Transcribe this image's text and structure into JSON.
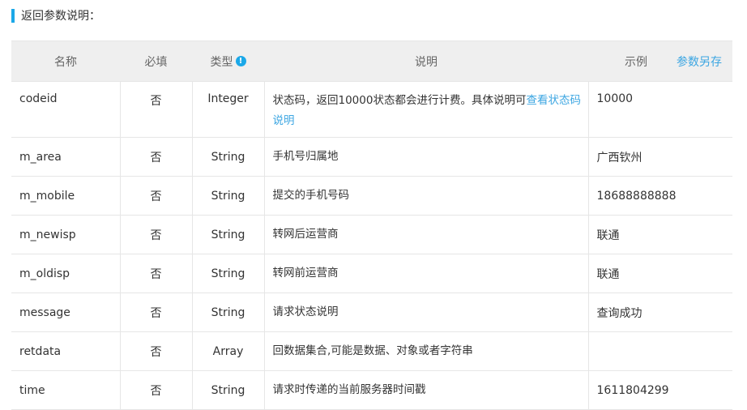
{
  "section_title": "返回参数说明：",
  "table": {
    "headers": {
      "name": "名称",
      "required": "必填",
      "type": "类型",
      "description": "说明",
      "example": "示例",
      "save_link": "参数另存"
    },
    "codeid": {
      "name": "codeid",
      "required": "否",
      "type": "Integer",
      "desc_text": "状态码，返回10000状态都会进行计费。具体说明可",
      "desc_link": "查看状态码说明",
      "example": "10000"
    },
    "rows": [
      {
        "name": "m_area",
        "required": "否",
        "type": "String",
        "desc": "手机号归属地",
        "example": "广西钦州"
      },
      {
        "name": "m_mobile",
        "required": "否",
        "type": "String",
        "desc": "提交的手机号码",
        "example": "18688888888"
      },
      {
        "name": "m_newisp",
        "required": "否",
        "type": "String",
        "desc": "转网后运营商",
        "example": "联通"
      },
      {
        "name": "m_oldisp",
        "required": "否",
        "type": "String",
        "desc": "转网前运营商",
        "example": "联通"
      },
      {
        "name": "message",
        "required": "否",
        "type": "String",
        "desc": "请求状态说明",
        "example": "查询成功"
      },
      {
        "name": "retdata",
        "required": "否",
        "type": "Array",
        "desc": "回数据集合,可能是数据、对象或者字符串",
        "example": ""
      },
      {
        "name": "time",
        "required": "否",
        "type": "String",
        "desc": "请求时传递的当前服务器时间戳",
        "example": "1611804299"
      }
    ]
  },
  "icons": {
    "type_info": "info-icon"
  },
  "colors": {
    "accent": "#1ba8e8",
    "link": "#3ca6e2",
    "header_bg": "#efefef"
  }
}
